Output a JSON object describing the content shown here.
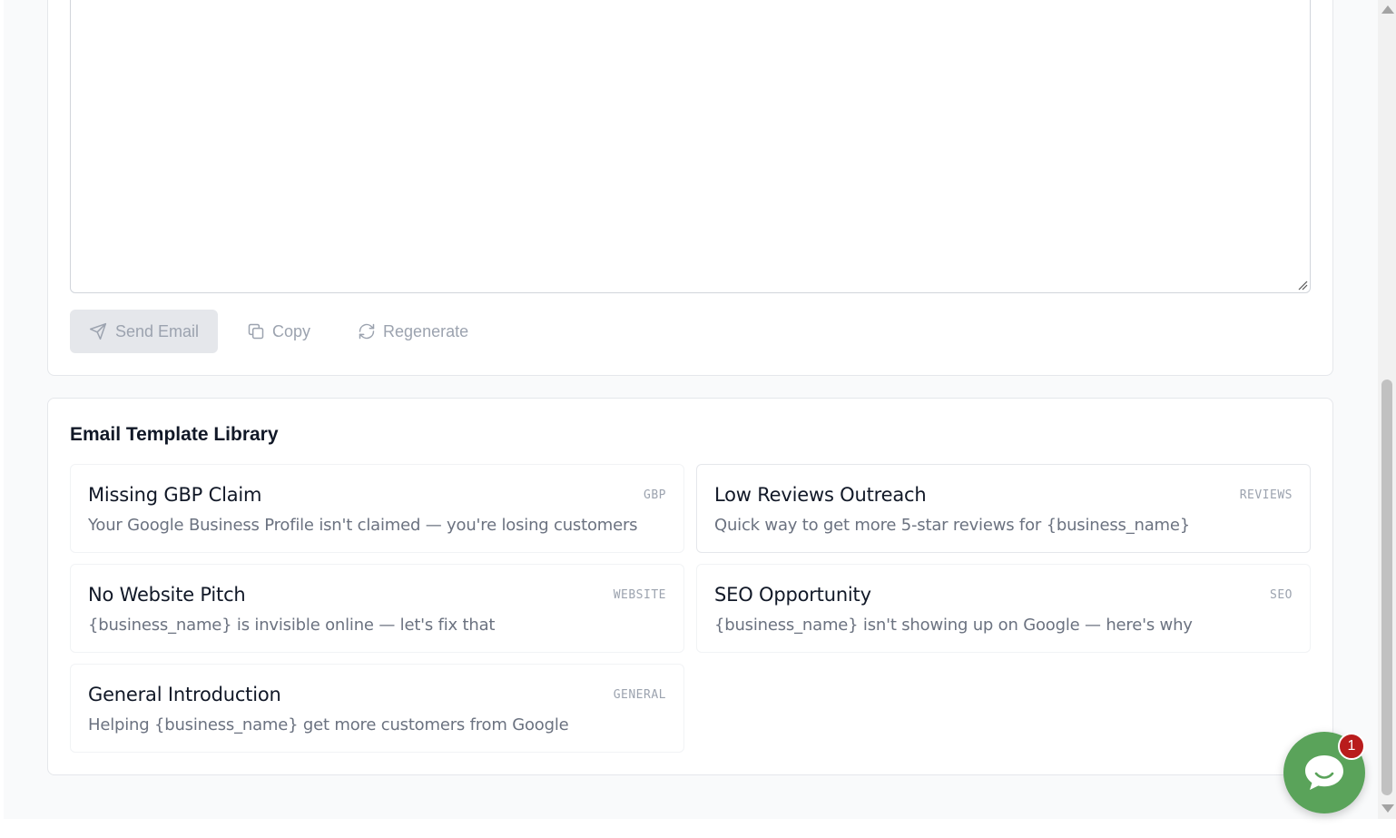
{
  "composer": {
    "body_value": "",
    "send_label": "Send Email",
    "copy_label": "Copy",
    "regenerate_label": "Regenerate"
  },
  "library": {
    "title": "Email Template Library",
    "templates": [
      {
        "title": "Missing GBP Claim",
        "tag": "GBP",
        "subject": "Your Google Business Profile isn't claimed — you're losing customers"
      },
      {
        "title": "Low Reviews Outreach",
        "tag": "REVIEWS",
        "subject": "Quick way to get more 5-star reviews for {business_name}"
      },
      {
        "title": "No Website Pitch",
        "tag": "WEBSITE",
        "subject": "{business_name} is invisible online — let's fix that"
      },
      {
        "title": "SEO Opportunity",
        "tag": "SEO",
        "subject": "{business_name} isn't showing up on Google — here's why"
      },
      {
        "title": "General Introduction",
        "tag": "GENERAL",
        "subject": "Helping {business_name} get more customers from Google"
      }
    ]
  },
  "chat": {
    "badge_count": "1",
    "color": "#5aa35a",
    "icon": "chat-bubble-icon"
  },
  "colors": {
    "disabled_text": "#9ca3af",
    "badge": "#b91c1c"
  }
}
